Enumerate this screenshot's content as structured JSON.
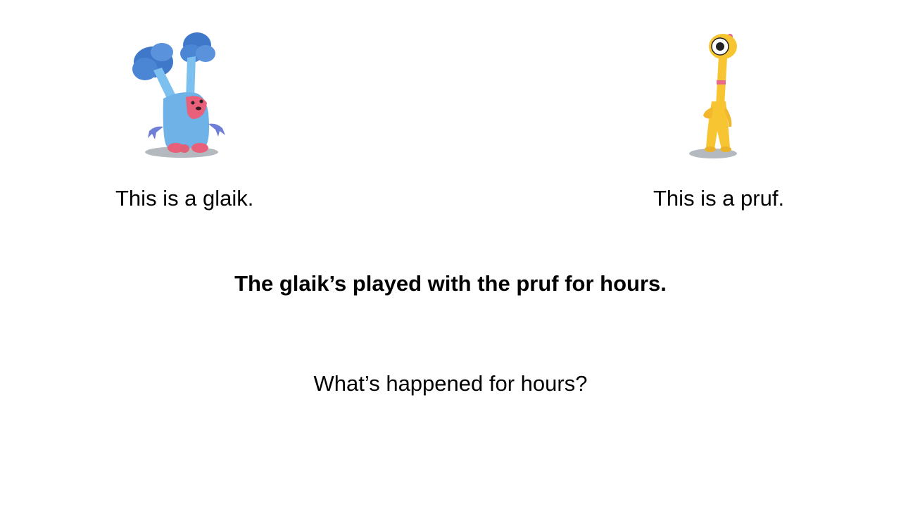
{
  "slide": {
    "glaik_caption": "This is a glaik.",
    "pruf_caption": "This is a pruf.",
    "statement": "The glaik’s played with the pruf for hours.",
    "question": "What’s happened for hours?"
  },
  "illustrations": {
    "left": {
      "icon": "glaik-creature-icon",
      "body_color": "#6fb2e8",
      "accent_color": "#e8607a",
      "tuft_color": "#3f78c8"
    },
    "right": {
      "icon": "pruf-creature-icon",
      "body_color": "#f7c531",
      "accent_color": "#e86a8a"
    }
  }
}
